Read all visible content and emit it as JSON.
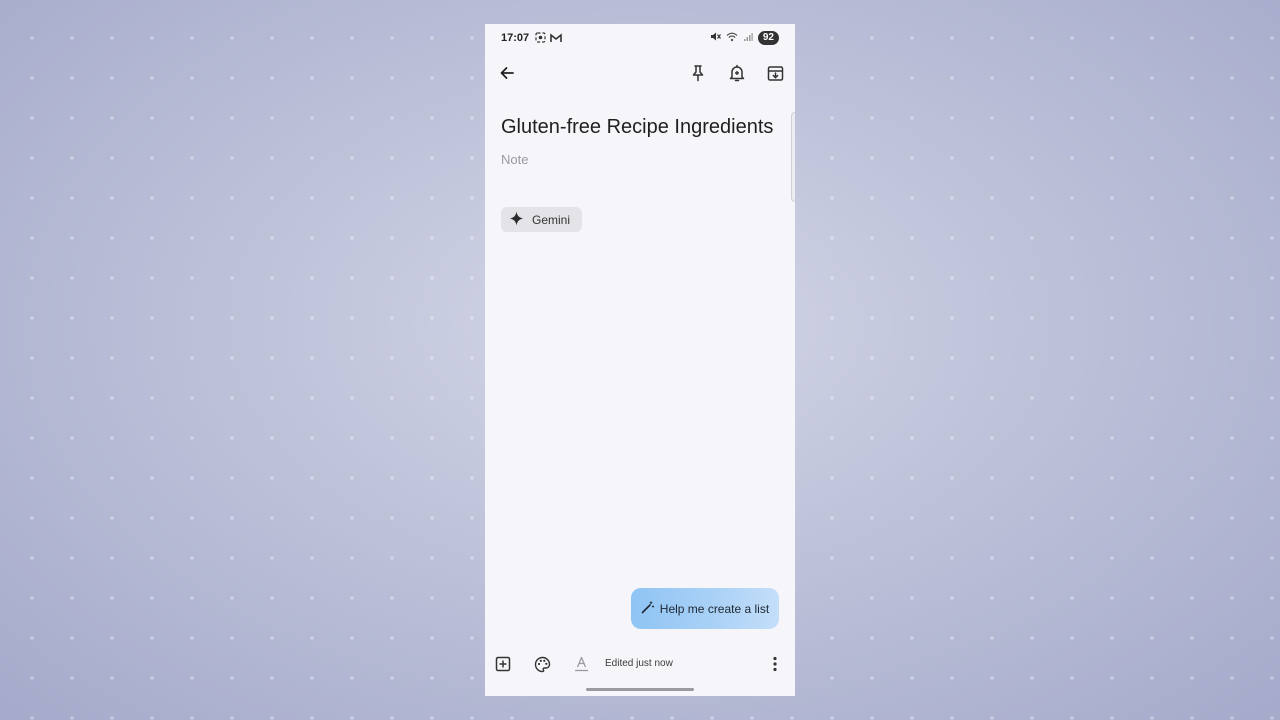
{
  "statusbar": {
    "time": "17:07",
    "battery": "92",
    "icons": [
      "screenshot-icon",
      "gmail-icon",
      "mute-icon",
      "wifi-icon",
      "signal-icon"
    ]
  },
  "toolbar": {
    "icons": [
      "back-arrow-icon",
      "pin-icon",
      "reminder-bell-icon",
      "archive-icon"
    ]
  },
  "note": {
    "title": "Gluten-free Recipe Ingredients",
    "body_placeholder": "Note"
  },
  "gemini_chip": {
    "label": "Gemini",
    "icon": "sparkle-icon"
  },
  "help_button": {
    "label": "Help me create a list",
    "icon": "magic-wand-icon"
  },
  "bottombar": {
    "edited_text": "Edited just now",
    "icons": [
      "add-box-icon",
      "palette-icon",
      "text-format-icon",
      "more-vert-icon"
    ]
  },
  "colors": {
    "screen_bg": "#f6f5fa",
    "chip_bg": "#e3e3e8",
    "help_gradient_start": "#8fc4f4",
    "help_gradient_end": "#c4def9",
    "wallpaper": "#b9bdd6"
  }
}
